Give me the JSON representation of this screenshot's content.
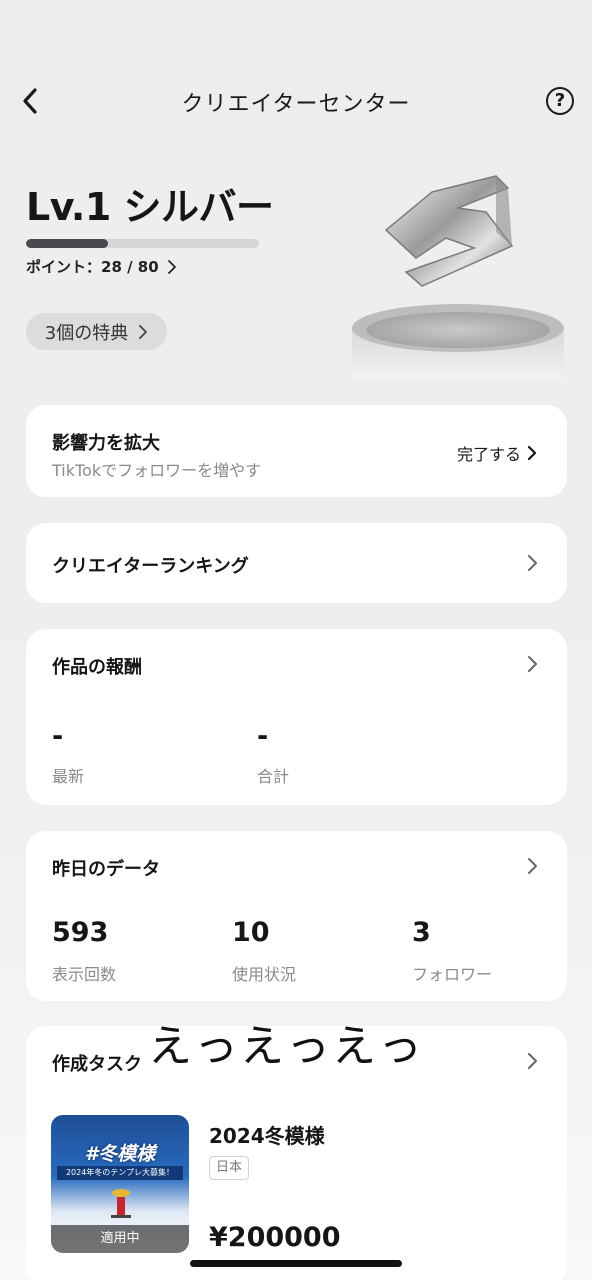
{
  "header": {
    "title": "クリエイターセンター",
    "back_icon": "chevron-left-icon",
    "help_icon": "question-circle-icon",
    "help_glyph": "?"
  },
  "level": {
    "title": "Lv.1 シルバー",
    "points_text": "ポイント：28 / 80",
    "points_current": 28,
    "points_max": 80,
    "progress_fraction": 0.35,
    "benefits_label": "3個の特典"
  },
  "influence_card": {
    "title": "影響力を拡大",
    "subtitle": "TikTokでフォロワーを増やす",
    "action_label": "完了する"
  },
  "ranking_card": {
    "title": "クリエイターランキング"
  },
  "rewards_card": {
    "title": "作品の報酬",
    "latest_value": "-",
    "latest_label": "最新",
    "total_value": "-",
    "total_label": "合計"
  },
  "yesterday_card": {
    "title": "昨日のデータ",
    "stats": [
      {
        "value": "593",
        "label": "表示回数"
      },
      {
        "value": "10",
        "label": "使用状況"
      },
      {
        "value": "3",
        "label": "フォロワー"
      }
    ]
  },
  "tasks_card": {
    "title": "作成タスク",
    "task": {
      "name": "2024冬模様",
      "region_tag": "日本",
      "reward": "¥200000",
      "thumbnail_title": "#冬模様",
      "thumbnail_subtitle": "2024年冬のテンプレ大募集！",
      "thumbnail_badge": "適用中"
    }
  },
  "overlay": {
    "handwritten_text": "えっえっえっ"
  },
  "colors": {
    "progress_fill": "#4a4a4e",
    "progress_track": "#d6d6d6",
    "card_bg": "#ffffff"
  }
}
